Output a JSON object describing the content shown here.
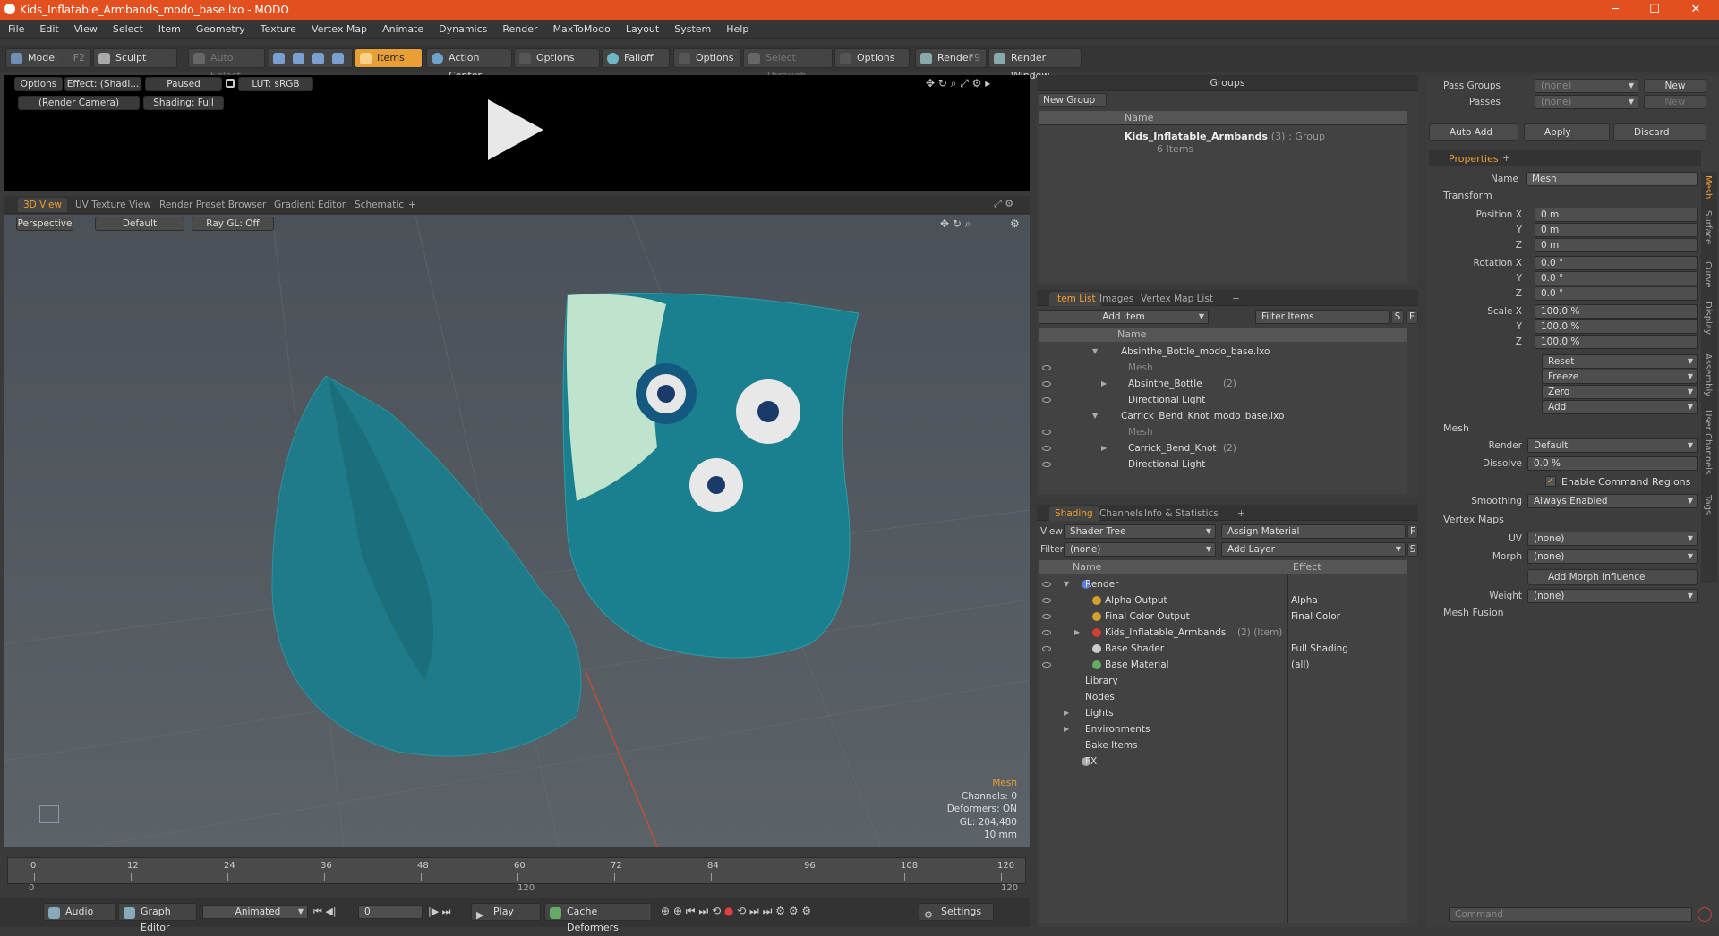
{
  "titlebar": {
    "title": "Kids_Inflatable_Armbands_modo_base.lxo - MODO",
    "min": "─",
    "max": "☐",
    "close": "✕"
  },
  "menu": [
    "File",
    "Edit",
    "View",
    "Select",
    "Item",
    "Geometry",
    "Texture",
    "Vertex Map",
    "Animate",
    "Dynamics",
    "Render",
    "MaxToModo",
    "Layout",
    "System",
    "Help"
  ],
  "toolbar": {
    "model": "Model",
    "model_key": "F2",
    "sculpt": "Sculpt",
    "auto_select": "Auto Select",
    "items": "Items",
    "action_center": "Action Center",
    "options1": "Options",
    "falloff": "Falloff",
    "options2": "Options",
    "select_through": "Select Through",
    "options3": "Options",
    "render": "Render",
    "render_key": "F9",
    "render_window": "Render Window"
  },
  "render_view": {
    "options": "Options",
    "effect": "Effect: (Shadi...",
    "paused": "Paused",
    "lut": "LUT: sRGB",
    "camera": "(Render Camera)",
    "shading": "Shading: Full"
  },
  "viewport_tabs": [
    "3D View",
    "UV Texture View",
    "Render Preset Browser",
    "Gradient Editor",
    "Schematic",
    "+"
  ],
  "viewport": {
    "perspective": "Perspective",
    "default": "Default",
    "raygl": "Ray GL: Off",
    "info_title": "Mesh",
    "info_lines": [
      "Channels: 0",
      "Deformers: ON",
      "GL: 204,480",
      "10 mm"
    ]
  },
  "timeline": {
    "ticks": [
      "0",
      "12",
      "24",
      "36",
      "48",
      "60",
      "72",
      "84",
      "96",
      "108",
      "120"
    ],
    "sub_ticks": [
      "0",
      "120",
      "120"
    ]
  },
  "bottombar": {
    "audio": "Audio",
    "graph_editor": "Graph Editor",
    "animated": "Animated",
    "frame": "0",
    "play": "Play",
    "cache_deformers": "Cache Deformers",
    "settings": "Settings"
  },
  "groups": {
    "title": "Groups",
    "new_group": "New Group",
    "col_name": "Name",
    "item_name": "Kids_Inflatable_Armbands",
    "item_count": "(3)",
    "item_type": ": Group",
    "item_sub": "6 Items"
  },
  "itemlist": {
    "tabs": [
      "Item List",
      "Images",
      "Vertex Map List",
      "+"
    ],
    "add_item": "Add Item",
    "filter": "Filter Items",
    "s": "S",
    "f": "F",
    "col_name": "Name",
    "rows": [
      {
        "label": "Absinthe_Bottle_modo_base.lxo",
        "indent": 0,
        "expand": "▼",
        "dim": false,
        "count": ""
      },
      {
        "label": "Mesh",
        "indent": 1,
        "expand": "",
        "dim": true,
        "count": ""
      },
      {
        "label": "Absinthe_Bottle",
        "indent": 1,
        "expand": "▶",
        "dim": false,
        "count": "(2)"
      },
      {
        "label": "Directional Light",
        "indent": 1,
        "expand": "",
        "dim": false,
        "count": ""
      },
      {
        "label": "Carrick_Bend_Knot_modo_base.lxo",
        "indent": 0,
        "expand": "▼",
        "dim": false,
        "count": ""
      },
      {
        "label": "Mesh",
        "indent": 1,
        "expand": "",
        "dim": true,
        "count": ""
      },
      {
        "label": "Carrick_Bend_Knot",
        "indent": 1,
        "expand": "▶",
        "dim": false,
        "count": "(2)"
      },
      {
        "label": "Directional Light",
        "indent": 1,
        "expand": "",
        "dim": false,
        "count": ""
      }
    ]
  },
  "shading": {
    "tabs": [
      "Shading",
      "Channels",
      "Info & Statistics",
      "+"
    ],
    "view_label": "View",
    "view_value": "Shader Tree",
    "assign_material": "Assign Material",
    "f": "F",
    "filter_label": "Filter",
    "filter_value": "(none)",
    "add_layer": "Add Layer",
    "s": "S",
    "col_name": "Name",
    "col_effect": "Effect",
    "rows": [
      {
        "label": "Render",
        "effect": "",
        "indent": 0,
        "expand": "▼",
        "count": ""
      },
      {
        "label": "Alpha Output",
        "effect": "Alpha",
        "indent": 1,
        "expand": "",
        "count": ""
      },
      {
        "label": "Final Color Output",
        "effect": "Final Color",
        "indent": 1,
        "expand": "",
        "count": ""
      },
      {
        "label": "Kids_Inflatable_Armbands",
        "effect": "",
        "indent": 1,
        "expand": "▶",
        "count": "(2) (Item)"
      },
      {
        "label": "Base Shader",
        "effect": "Full Shading",
        "indent": 1,
        "expand": "",
        "count": ""
      },
      {
        "label": "Base Material",
        "effect": "(all)",
        "indent": 1,
        "expand": "",
        "count": ""
      },
      {
        "label": "Library",
        "effect": "",
        "indent": 0,
        "expand": "",
        "count": ""
      },
      {
        "label": "Nodes",
        "effect": "",
        "indent": 0,
        "expand": "",
        "count": ""
      },
      {
        "label": "Lights",
        "effect": "",
        "indent": 0,
        "expand": "▶",
        "count": ""
      },
      {
        "label": "Environments",
        "effect": "",
        "indent": 0,
        "expand": "▶",
        "count": ""
      },
      {
        "label": "Bake Items",
        "effect": "",
        "indent": 0,
        "expand": "",
        "count": ""
      },
      {
        "label": "FX",
        "effect": "",
        "indent": 0,
        "expand": "",
        "count": ""
      }
    ]
  },
  "right": {
    "pass_groups": "Pass Groups",
    "passes": "Passes",
    "none": "(none)",
    "new": "New",
    "auto_add": "Auto Add",
    "apply": "Apply",
    "discard": "Discard",
    "properties": "Properties",
    "plus": "+",
    "name_label": "Name",
    "name_value": "Mesh",
    "transform": "Transform",
    "position_x": "Position X",
    "rotation_x": "Rotation X",
    "scale_x": "Scale X",
    "y": "Y",
    "z": "Z",
    "pos": [
      "0 m",
      "0 m",
      "0 m"
    ],
    "rot": [
      "0.0 °",
      "0.0 °",
      "0.0 °"
    ],
    "scale": [
      "100.0 %",
      "100.0 %",
      "100.0 %"
    ],
    "reset": "Reset",
    "freeze": "Freeze",
    "zero": "Zero",
    "add": "Add",
    "mesh": "Mesh",
    "render_label": "Render",
    "render_value": "Default",
    "dissolve_label": "Dissolve",
    "dissolve_value": "0.0 %",
    "enable_cmd": "Enable Command Regions",
    "smoothing_label": "Smoothing",
    "smoothing_value": "Always Enabled",
    "vertex_maps": "Vertex Maps",
    "uv_label": "UV",
    "morph_label": "Morph",
    "add_morph": "Add Morph Influence",
    "weight_label": "Weight",
    "mesh_fusion": "Mesh Fusion",
    "command": "Command",
    "side_tabs": [
      "Mesh",
      "Surface",
      "Curve",
      "Display",
      "Assembly",
      "User Channels",
      "Tags"
    ]
  }
}
